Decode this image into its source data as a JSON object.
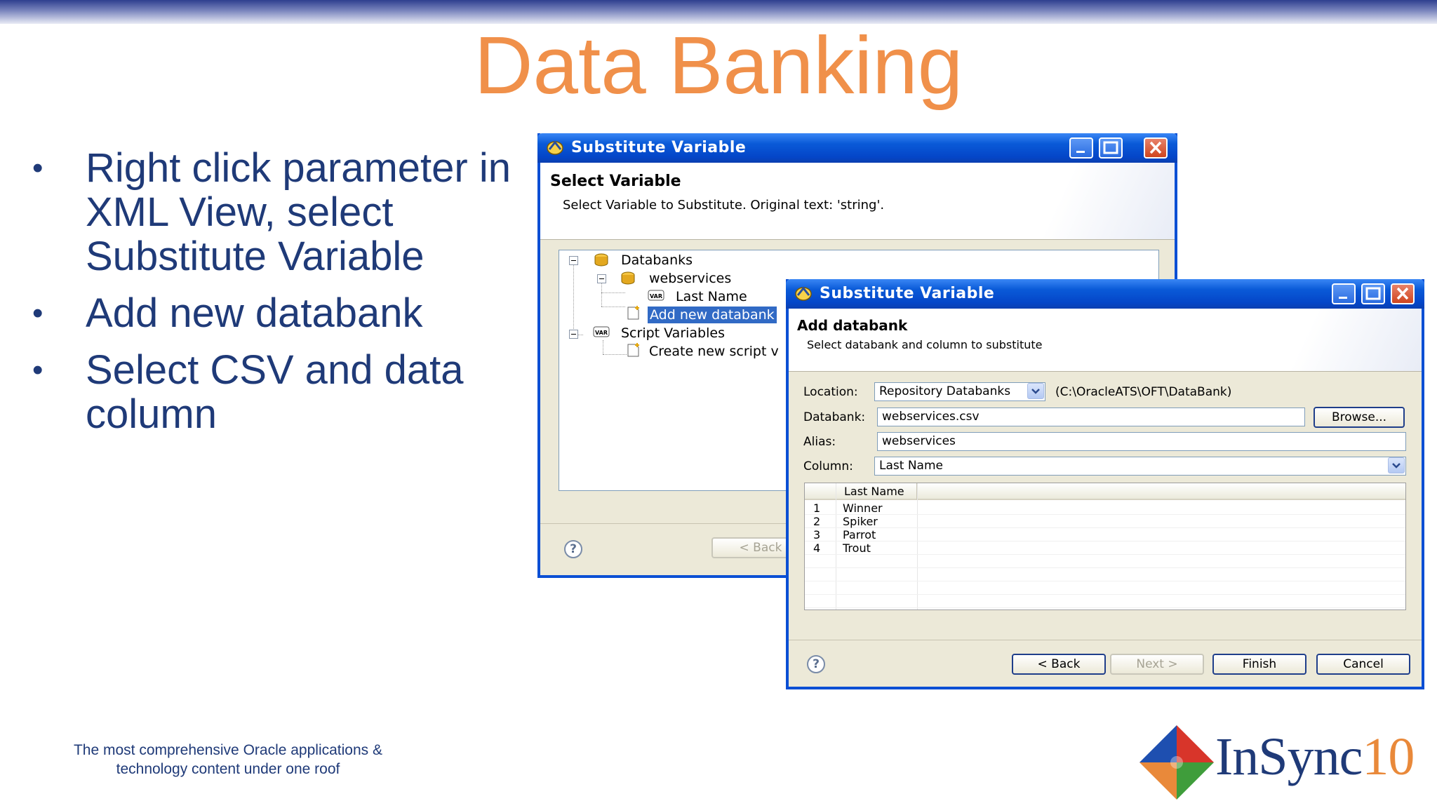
{
  "slide": {
    "title": "Data Banking",
    "bullets": [
      "Right click parameter in XML View, select Substitute Variable",
      "Add new databank",
      "Select CSV and data column"
    ],
    "tagline": "The most comprehensive Oracle applications & technology content under one roof",
    "logo": {
      "text": "InSync",
      "number": "10"
    }
  },
  "back_dialog": {
    "title": "Substitute Variable",
    "heading": "Select Variable",
    "subheading": "Select Variable to Substitute.  Original text: 'string'.",
    "tree": {
      "databanks": "Databanks",
      "webservices": "webservices",
      "last_name": "Last Name",
      "add_new": "Add new databank",
      "script_variables": "Script Variables",
      "create_new": "Create new script v"
    },
    "back_button": "< Back",
    "help": "?"
  },
  "front_dialog": {
    "title": "Substitute Variable",
    "heading": "Add databank",
    "subheading": "Select databank and column to substitute",
    "location_label": "Location:",
    "location_value": "Repository Databanks",
    "location_path": "(C:\\OracleATS\\OFT\\DataBank)",
    "databank_label": "Databank:",
    "databank_value": "webservices.csv",
    "browse_button": "Browse...",
    "alias_label": "Alias:",
    "alias_value": "webservices",
    "column_label": "Column:",
    "column_value": "Last Name",
    "grid": {
      "column_header": "Last Name",
      "rows": [
        {
          "index": "1",
          "value": "Winner"
        },
        {
          "index": "2",
          "value": "Spiker"
        },
        {
          "index": "3",
          "value": "Parrot"
        },
        {
          "index": "4",
          "value": "Trout"
        }
      ]
    },
    "buttons": {
      "back": "< Back",
      "next": "Next >",
      "finish": "Finish",
      "cancel": "Cancel"
    },
    "help": "?"
  }
}
